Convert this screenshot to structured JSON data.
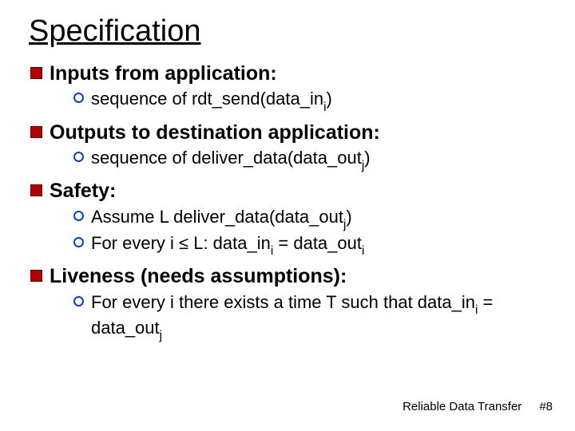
{
  "title": "Specification",
  "bullets": {
    "b1": {
      "label_a": "Inputs from application:"
    },
    "b1s1": {
      "pre": "sequence of rdt_send(data_in",
      "sub": "i",
      "post": ")"
    },
    "b2": {
      "label_a": "Outputs to destination application:"
    },
    "b2s1": {
      "pre": "sequence of deliver_data(data_out",
      "sub": "j",
      "post": ")"
    },
    "b3": {
      "label_a": "Safety:"
    },
    "b3s1": {
      "pre": "Assume L deliver_data(data_out",
      "sub": "j",
      "post": ")"
    },
    "b3s2": {
      "a": "For every i ",
      "le": "≤",
      "b": " L: data_in",
      "sub1": "i",
      "c": " = data_out",
      "sub2": "i"
    },
    "b4": {
      "label_a": "Liveness",
      "label_b": " (needs assumptions):"
    },
    "b4s1": {
      "a": "For every  i there exists a time T such that data_in",
      "sub1": "i",
      "b": "  = data_out",
      "sub2": "j"
    }
  },
  "footer": {
    "topic": "Reliable Data Transfer",
    "page": "#8"
  }
}
